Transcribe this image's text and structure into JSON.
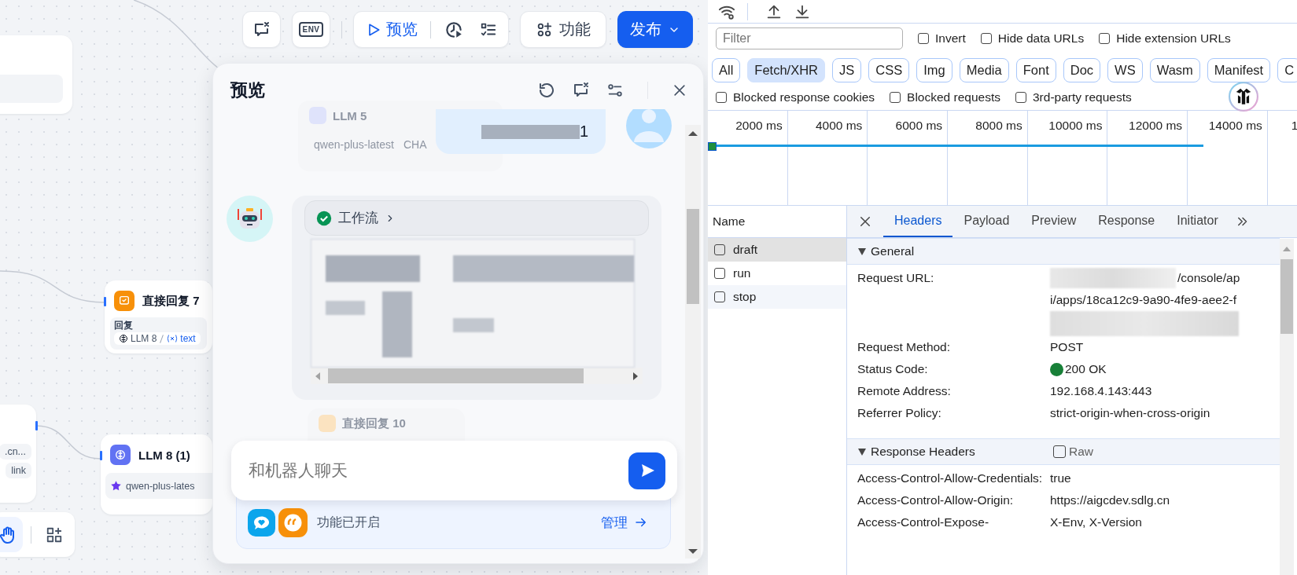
{
  "toolbar": {
    "env_label": "ENV",
    "preview_label": "预览",
    "features_label": "功能",
    "publish_label": "发布"
  },
  "canvas": {
    "partial_node_tags": [
      ".cn...",
      "link"
    ],
    "nodes": [
      {
        "kind": "reply",
        "title": "直接回复 7",
        "field_label": "回复",
        "source": "LLM 8",
        "variable": "text"
      },
      {
        "kind": "llm",
        "title": "LLM 8 (1)",
        "model": "qwen-plus-lates"
      }
    ],
    "faded_nodes": [
      {
        "kind": "llm",
        "title": "LLM 5",
        "model": "qwen-plus-latest",
        "tag": "CHA"
      },
      {
        "kind": "reply",
        "title": "直接回复 10"
      }
    ],
    "tools": [
      {
        "kind": "hand",
        "selected": true
      },
      {
        "kind": "add-block",
        "selected": false
      }
    ]
  },
  "preview": {
    "title": "预览",
    "messages": [
      {
        "kind": "user",
        "text": "1"
      },
      {
        "kind": "bot",
        "workflow_label": "工作流",
        "workflow_succeeded": true
      }
    ],
    "input": {
      "placeholder": "和机器人聊天"
    },
    "features": {
      "status": "功能已开启",
      "link": "管理"
    }
  },
  "devtools": {
    "filter": {
      "placeholder": "Filter"
    },
    "filter_options": [
      {
        "label": "Invert",
        "checked": false
      },
      {
        "label": "Hide data URLs",
        "checked": false
      },
      {
        "label": "Hide extension URLs",
        "checked": false
      }
    ],
    "type_filters": [
      {
        "label": "All",
        "selected": false
      },
      {
        "label": "Fetch/XHR",
        "selected": true
      },
      {
        "label": "JS",
        "selected": false
      },
      {
        "label": "CSS",
        "selected": false
      },
      {
        "label": "Img",
        "selected": false
      },
      {
        "label": "Media",
        "selected": false
      },
      {
        "label": "Font",
        "selected": false
      },
      {
        "label": "Doc",
        "selected": false
      },
      {
        "label": "WS",
        "selected": false
      },
      {
        "label": "Wasm",
        "selected": false
      },
      {
        "label": "Manifest",
        "selected": false
      },
      {
        "label": "C",
        "selected": false
      }
    ],
    "block_options": [
      {
        "label": "Blocked response cookies",
        "checked": false
      },
      {
        "label": "Blocked requests",
        "checked": false
      },
      {
        "label": "3rd-party requests",
        "checked": false
      }
    ],
    "timeline_ticks": [
      "2000 ms",
      "4000 ms",
      "6000 ms",
      "8000 ms",
      "10000 ms",
      "12000 ms",
      "14000 ms",
      "1"
    ],
    "name_header": "Name",
    "requests": [
      {
        "name": "draft",
        "selected": true,
        "checked": false
      },
      {
        "name": "run",
        "selected": false,
        "checked": false
      },
      {
        "name": "stop",
        "selected": false,
        "checked": false
      }
    ],
    "detail_tabs": [
      {
        "label": "Headers",
        "selected": true
      },
      {
        "label": "Payload",
        "selected": false
      },
      {
        "label": "Preview",
        "selected": false
      },
      {
        "label": "Response",
        "selected": false
      },
      {
        "label": "Initiator",
        "selected": false
      }
    ],
    "general": {
      "title": "General",
      "expanded": true,
      "rows": [
        {
          "kind": "redacted-url",
          "label": "Request URL:",
          "lines": [
            "/console/ap",
            "i/apps/18ca12c9-9a90-4fe9-aee2-f"
          ]
        },
        {
          "kind": "text",
          "label": "Request Method:",
          "value": "POST"
        },
        {
          "kind": "status",
          "label": "Status Code:",
          "value": "200 OK"
        },
        {
          "kind": "text",
          "label": "Remote Address:",
          "value": "192.168.4.143:443"
        },
        {
          "kind": "text",
          "label": "Referrer Policy:",
          "value": "strict-origin-when-cross-origin"
        }
      ]
    },
    "response_headers": {
      "title": "Response Headers",
      "expanded": true,
      "raw": {
        "label": "Raw",
        "checked": false
      },
      "rows": [
        {
          "kind": "text",
          "label": "Access-Control-Allow-Credentials:",
          "value": "true"
        },
        {
          "kind": "text",
          "label": "Access-Control-Allow-Origin:",
          "value": "https://aigcdev.sdlg.cn"
        },
        {
          "kind": "text",
          "label": "Access-Control-Expose-",
          "value": "X-Env, X-Version"
        }
      ]
    }
  }
}
